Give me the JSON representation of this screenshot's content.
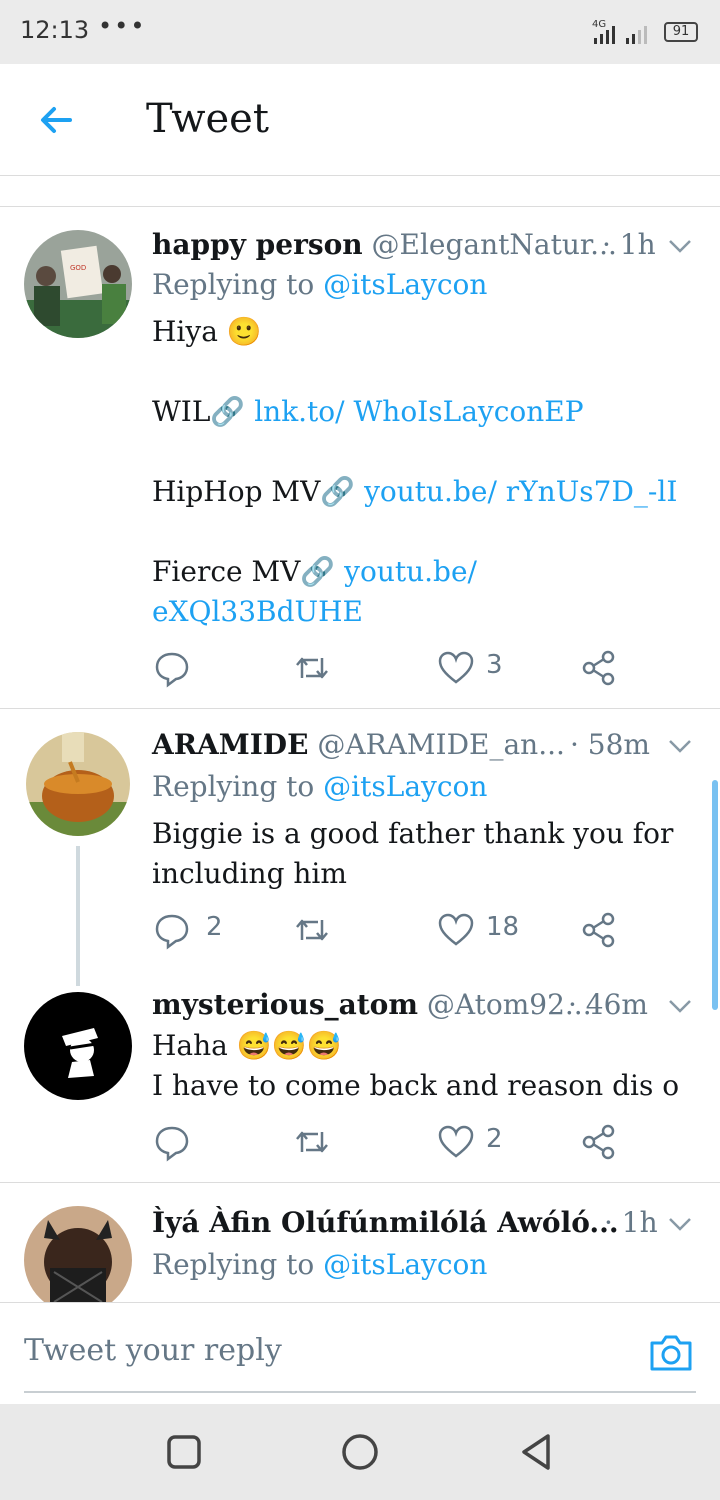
{
  "status_bar": {
    "time": "12:13",
    "dots": "•••",
    "network": "4G",
    "battery": "91"
  },
  "header": {
    "title": "Tweet",
    "back_icon": "back-arrow-icon"
  },
  "tweets": [
    {
      "name": "happy person",
      "handle": "@ElegantNatur...",
      "time": "· 1h",
      "replying_prefix": "Replying to ",
      "replying_to": "@itsLaycon",
      "line1": "Hiya 🙂",
      "line2_text": "WIL🔗 ",
      "line2_link": "lnk.to/ WhoIsLayconEP",
      "line3_text": "HipHop MV🔗 ",
      "line3_link": "youtu.be/ rYnUs7D_-lI",
      "line4_text": "Fierce MV🔗 ",
      "line4_link1": "youtu.be/",
      "line4_link2": "eXQl33BdUHE",
      "reply_count": "",
      "like_count": "3"
    },
    {
      "name": "ARAMIDE",
      "handle": "@ARAMIDE_an...",
      "time": "· 58m",
      "replying_prefix": "Replying to ",
      "replying_to": "@itsLaycon",
      "line1": "Biggie is a good father thank you for",
      "line2": "including him",
      "reply_count": "2",
      "like_count": "18"
    },
    {
      "name": "mysterious_atom",
      "handle": "@Atom92...",
      "time": "· 46m",
      "line1": "Haha 😅😅😅",
      "line2": "I have to come back and reason dis o",
      "reply_count": "",
      "like_count": "2"
    },
    {
      "name": "Ìyá Àfin Olúfúnmilólá Awóló...",
      "handle": "",
      "time": "· 1h",
      "replying_prefix": "Replying to ",
      "replying_to": "@itsLaycon"
    }
  ],
  "reply_bar": {
    "placeholder": "Tweet your reply",
    "camera_icon": "camera-icon"
  },
  "colors": {
    "accent": "#1da1f2",
    "secondary_text": "#657786",
    "primary_text": "#14171a"
  }
}
